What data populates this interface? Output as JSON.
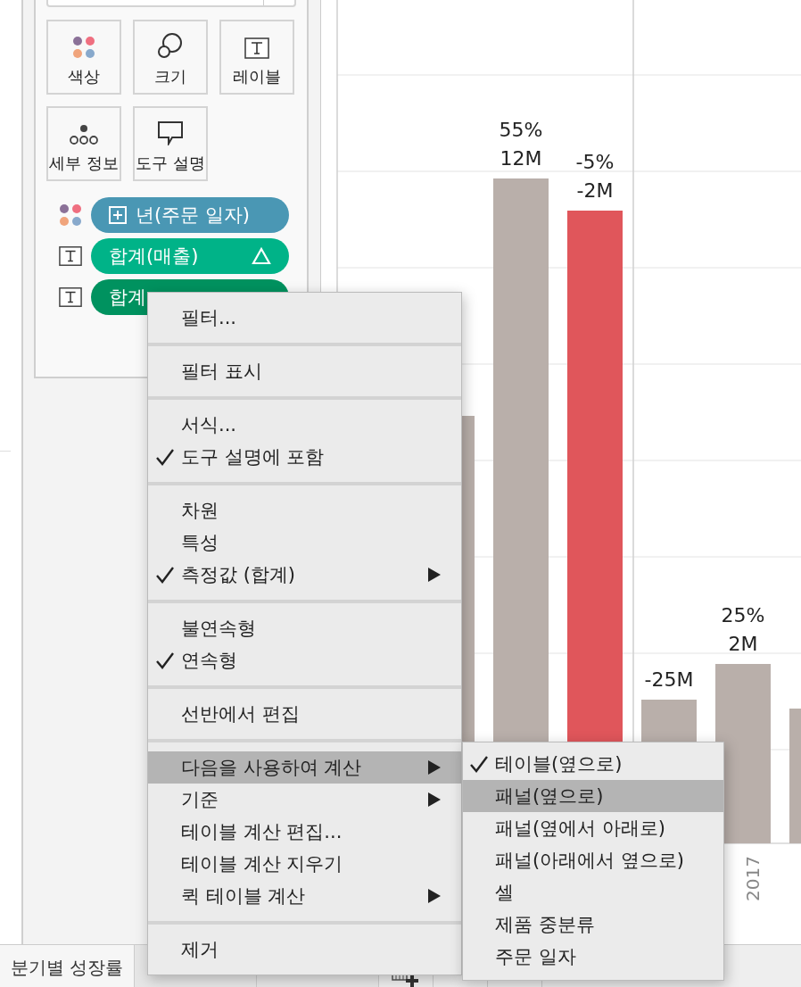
{
  "marks": {
    "buttons": [
      {
        "kind": "color",
        "label": "색상"
      },
      {
        "kind": "size",
        "label": "크기"
      },
      {
        "kind": "label",
        "label": "레이블"
      },
      {
        "kind": "detail",
        "label": "세부 정보"
      },
      {
        "kind": "tooltip",
        "label": "도구 설명"
      }
    ],
    "pills": [
      {
        "kind": "dimension",
        "label": "년(주문 일자)",
        "color": "#4a97b4"
      },
      {
        "kind": "calc",
        "label": "합계(매출)",
        "color": "#00b388"
      },
      {
        "kind": "measure",
        "label": "합계",
        "color": "#00925f"
      }
    ]
  },
  "chart": {
    "bars": [
      {
        "color": "#b9afaa"
      },
      {
        "labels": [
          "55%",
          "12M"
        ],
        "color": "#b9afaa"
      },
      {
        "labels": [
          "-5%",
          "-2M"
        ],
        "color": "#e0565b"
      },
      {
        "labels": [
          "-25M"
        ],
        "color": "#b9afaa"
      },
      {
        "labels": [
          "25%",
          "2M"
        ],
        "color": "#b9afaa",
        "category_label": "2017"
      },
      {
        "color": "#b9afaa"
      }
    ]
  },
  "context_menu": {
    "groups": [
      {
        "items": [
          {
            "label": "필터...",
            "checked": false,
            "has_submenu": false,
            "selected": false
          }
        ]
      },
      {
        "items": [
          {
            "label": "필터 표시",
            "checked": false,
            "has_submenu": false,
            "selected": false
          }
        ]
      },
      {
        "items": [
          {
            "label": "서식...",
            "checked": false,
            "has_submenu": false,
            "selected": false
          },
          {
            "label": "도구 설명에 포함",
            "checked": true,
            "has_submenu": false,
            "selected": false
          }
        ]
      },
      {
        "items": [
          {
            "label": "차원",
            "checked": false,
            "has_submenu": false,
            "selected": false
          },
          {
            "label": "특성",
            "checked": false,
            "has_submenu": false,
            "selected": false
          },
          {
            "label": "측정값 (합계)",
            "checked": true,
            "has_submenu": true,
            "selected": false
          }
        ]
      },
      {
        "items": [
          {
            "label": "불연속형",
            "checked": false,
            "has_submenu": false,
            "selected": false
          },
          {
            "label": "연속형",
            "checked": true,
            "has_submenu": false,
            "selected": false
          }
        ]
      },
      {
        "items": [
          {
            "label": "선반에서 편집",
            "checked": false,
            "has_submenu": false,
            "selected": false
          }
        ]
      },
      {
        "items": [
          {
            "label": "다음을 사용하여 계산",
            "checked": false,
            "has_submenu": true,
            "selected": true
          },
          {
            "label": "기준",
            "checked": false,
            "has_submenu": true,
            "selected": false
          },
          {
            "label": "테이블 계산 편집...",
            "checked": false,
            "has_submenu": false,
            "selected": false
          },
          {
            "label": "테이블 계산 지우기",
            "checked": false,
            "has_submenu": false,
            "selected": false
          },
          {
            "label": "퀵 테이블 계산",
            "checked": false,
            "has_submenu": true,
            "selected": false
          }
        ]
      },
      {
        "items": [
          {
            "label": "제거",
            "checked": false,
            "has_submenu": false,
            "selected": false
          }
        ]
      }
    ]
  },
  "submenu": {
    "items": [
      {
        "label": "테이블(옆으로)",
        "checked": true,
        "selected": false
      },
      {
        "label": "패널(옆으로)",
        "checked": false,
        "selected": true
      },
      {
        "label": "패널(옆에서 아래로)",
        "checked": false,
        "selected": false
      },
      {
        "label": "패널(아래에서 옆으로)",
        "checked": false,
        "selected": false
      },
      {
        "label": "셀",
        "checked": false,
        "selected": false
      },
      {
        "label": "제품 중분류",
        "checked": false,
        "selected": false
      },
      {
        "label": "주문 일자",
        "checked": false,
        "selected": false
      }
    ]
  },
  "sheet_tabs": [
    {
      "label": "분기별 성장률",
      "selected": true
    }
  ]
}
